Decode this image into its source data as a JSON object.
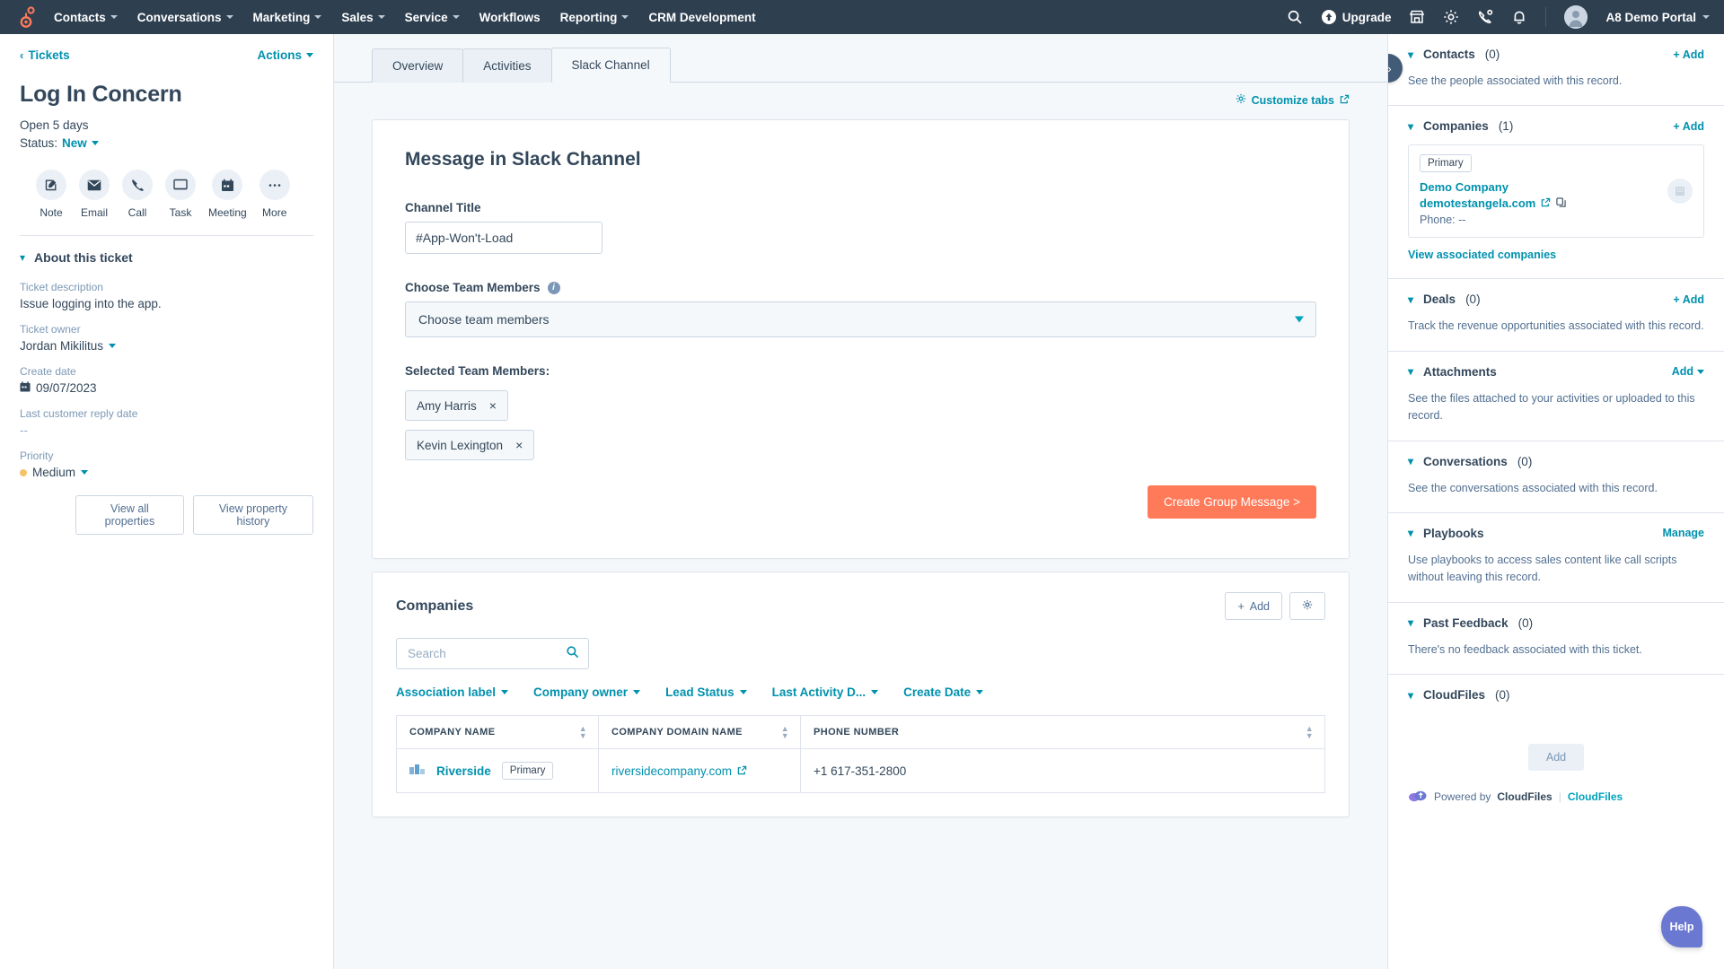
{
  "topnav": {
    "logo_icon": "hubspot-sprocket-logo",
    "items": [
      {
        "label": "Contacts",
        "has_caret": true
      },
      {
        "label": "Conversations",
        "has_caret": true
      },
      {
        "label": "Marketing",
        "has_caret": true
      },
      {
        "label": "Sales",
        "has_caret": true
      },
      {
        "label": "Service",
        "has_caret": true
      },
      {
        "label": "Workflows",
        "has_caret": false
      },
      {
        "label": "Reporting",
        "has_caret": true
      },
      {
        "label": "CRM Development",
        "has_caret": false
      }
    ],
    "search_icon": "search-icon",
    "upgrade_label": "Upgrade",
    "marketplace_icon": "marketplace-icon",
    "settings_icon": "gear-icon",
    "calls_icon": "phone-icon",
    "notifications_icon": "bell-icon",
    "portal_name": "A8 Demo Portal",
    "bg_color": "#2e3f50"
  },
  "left": {
    "back_label": "Tickets",
    "actions_label": "Actions",
    "title": "Log In Concern",
    "open_days": "Open 5 days",
    "status_label": "Status:",
    "status_value": "New",
    "quick_actions": [
      {
        "label": "Note",
        "icon": "note-pencil-icon"
      },
      {
        "label": "Email",
        "icon": "envelope-icon"
      },
      {
        "label": "Call",
        "icon": "phone-icon"
      },
      {
        "label": "Task",
        "icon": "task-icon"
      },
      {
        "label": "Meeting",
        "icon": "calendar-icon"
      },
      {
        "label": "More",
        "icon": "ellipsis-icon"
      }
    ],
    "about_title": "About this ticket",
    "properties": [
      {
        "label": "Ticket description",
        "value": "Issue logging into the app.",
        "type": "text"
      },
      {
        "label": "Ticket owner",
        "value": "Jordan Mikilitus",
        "type": "dropdown"
      },
      {
        "label": "Create date",
        "value": "09/07/2023",
        "type": "date"
      },
      {
        "label": "Last customer reply date",
        "value": "--",
        "type": "text"
      },
      {
        "label": "Priority",
        "value": "Medium",
        "type": "priority",
        "dot_color": "#f5c26b"
      }
    ],
    "view_all_properties": "View all properties",
    "view_property_history": "View property history"
  },
  "center": {
    "tabs": [
      {
        "label": "Overview",
        "active": false
      },
      {
        "label": "Activities",
        "active": false
      },
      {
        "label": "Slack Channel",
        "active": true
      }
    ],
    "customize_tabs": "Customize tabs",
    "customize_icon": "gear-icon",
    "external_link_icon": "external-link-icon",
    "slack": {
      "title": "Message in Slack Channel",
      "channel_title_label": "Channel Title",
      "channel_title_value": "#App-Won't-Load",
      "team_members_label": "Choose Team Members",
      "team_members_info_icon": "info-icon",
      "team_members_placeholder": "Choose team members",
      "selected_label": "Selected Team Members:",
      "selected_members": [
        "Amy Harris",
        "Kevin Lexington"
      ],
      "remove_glyph": "×",
      "cta_label": "Create Group Message >",
      "cta_color": "#ff7a59"
    },
    "companies": {
      "title": "Companies",
      "add_label": "Add",
      "settings_icon": "gear-icon",
      "search_placeholder": "Search",
      "search_icon": "search-icon",
      "filters": [
        "Association label",
        "Company owner",
        "Lead Status",
        "Last Activity D...",
        "Create Date"
      ],
      "columns": [
        "COMPANY NAME",
        "COMPANY DOMAIN NAME",
        "PHONE NUMBER"
      ],
      "rows": [
        {
          "company_name": "Riverside",
          "badge": "Primary",
          "domain": "riversidecompany.com",
          "phone": "+1 617-351-2800"
        }
      ]
    }
  },
  "right": {
    "collapse_icon": "double-chevron-right-icon",
    "sections": [
      {
        "title": "Contacts",
        "count": "(0)",
        "action": "+ Add",
        "desc": "See the people associated with this record."
      },
      {
        "title": "Companies",
        "count": "(1)",
        "action": "+ Add",
        "assoc": {
          "badge": "Primary",
          "name": "Demo Company",
          "domain": "demotestangela.com",
          "phone": "Phone: --",
          "copy_icon": "copy-icon",
          "external_link_icon": "external-link-icon",
          "thumb_icon": "building-icon"
        },
        "view_link": "View associated companies"
      },
      {
        "title": "Deals",
        "count": "(0)",
        "action": "+ Add",
        "desc": "Track the revenue opportunities associated with this record."
      },
      {
        "title": "Attachments",
        "count": "",
        "action": "Add",
        "action_caret": true,
        "desc": "See the files attached to your activities or uploaded to this record."
      },
      {
        "title": "Conversations",
        "count": "(0)",
        "action": "",
        "desc": "See the conversations associated with this record."
      },
      {
        "title": "Playbooks",
        "count": "",
        "action": "Manage",
        "desc": "Use playbooks to access sales content like call scripts without leaving this record."
      },
      {
        "title": "Past Feedback",
        "count": "(0)",
        "action": "",
        "desc": "There's no feedback associated with this ticket."
      }
    ],
    "cloudfiles": {
      "title": "CloudFiles",
      "count": "(0)",
      "add_label": "Add",
      "powered_by": "Powered by",
      "brand": "CloudFiles",
      "link": "CloudFiles"
    },
    "help_label": "Help",
    "help_color": "#6a78d1"
  }
}
